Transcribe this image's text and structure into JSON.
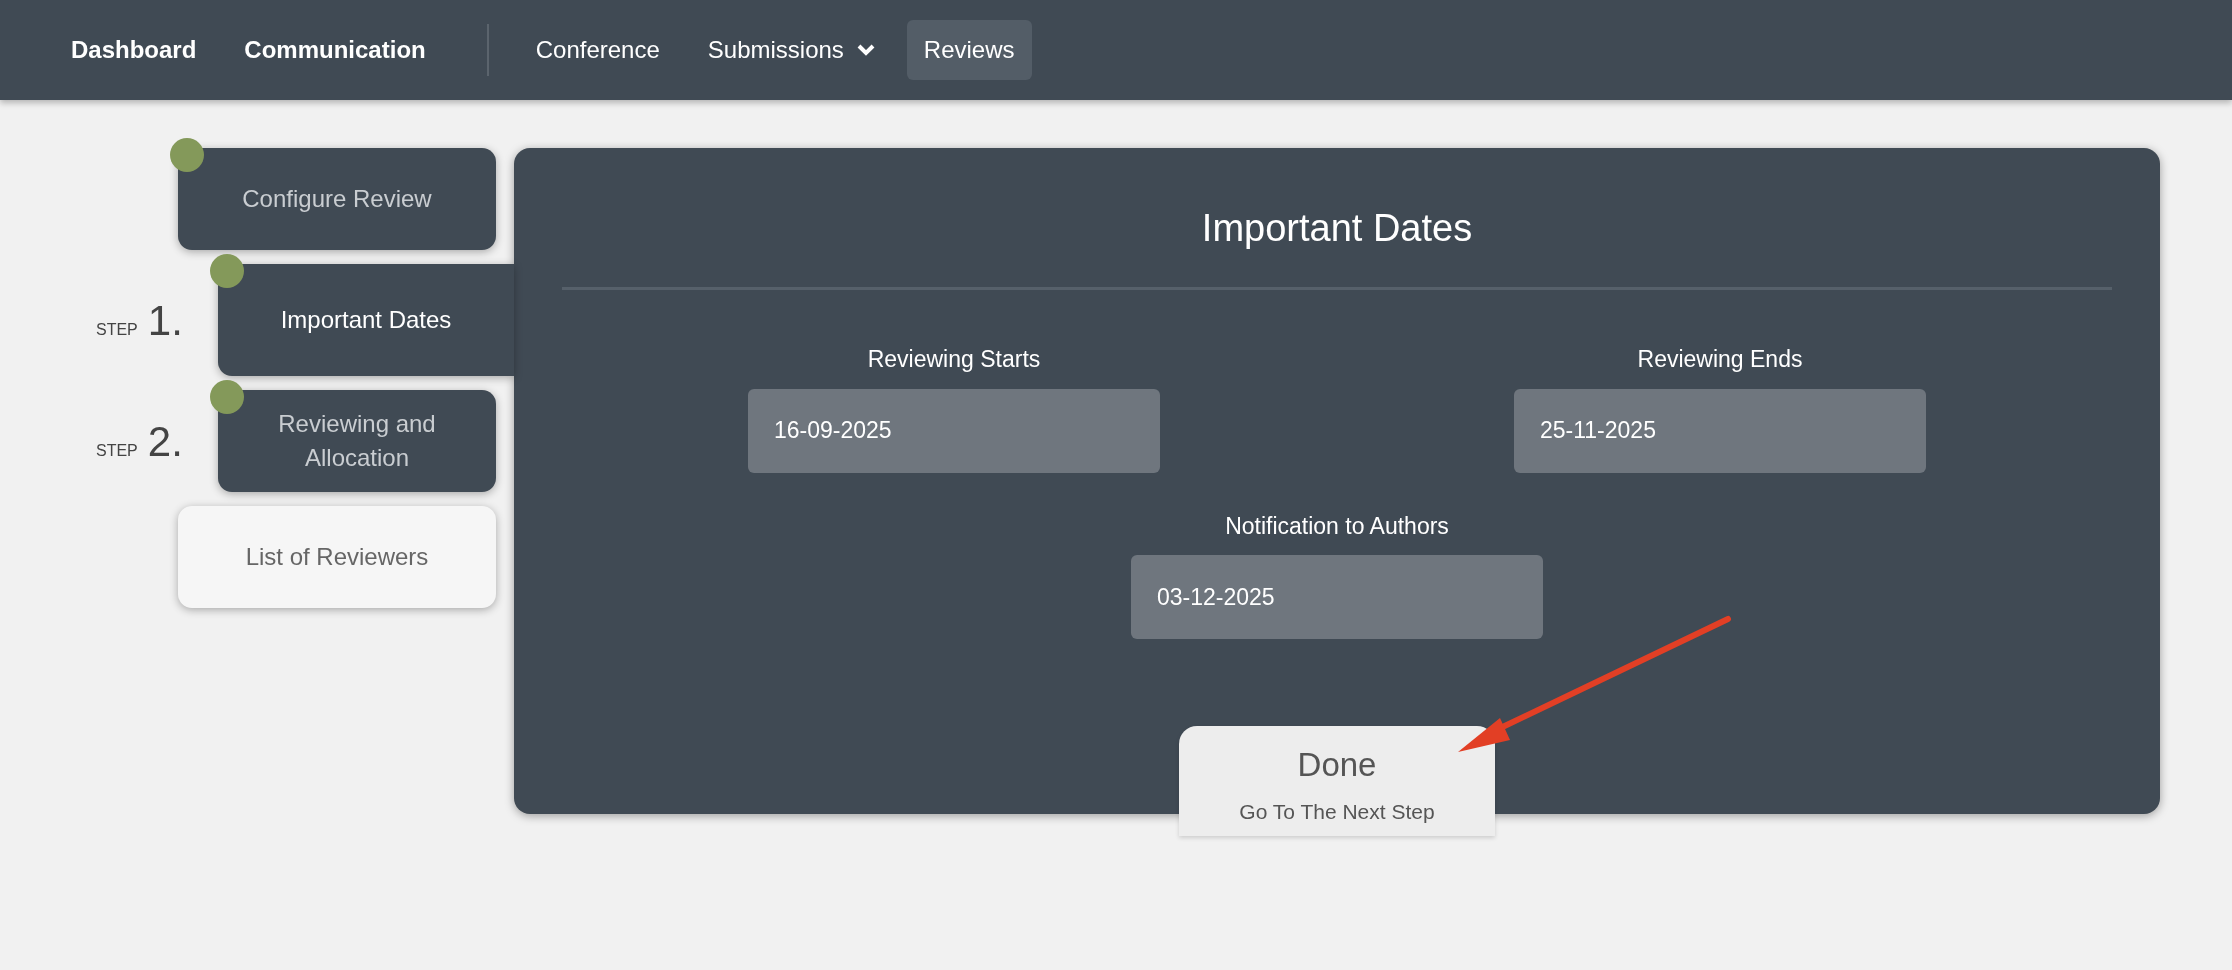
{
  "nav": [
    {
      "label": "Dashboard",
      "kind": "primary",
      "selected": false,
      "has_menu": false
    },
    {
      "label": "Communication",
      "kind": "primary",
      "selected": false,
      "has_menu": false
    },
    {
      "label": "Conference",
      "kind": "secondary",
      "selected": false,
      "has_menu": false
    },
    {
      "label": "Submissions",
      "kind": "secondary",
      "selected": false,
      "has_menu": true
    },
    {
      "label": "Reviews",
      "kind": "secondary",
      "selected": true,
      "has_menu": false
    }
  ],
  "steps": [
    {
      "label": "Configure Review",
      "kind": "stage",
      "completed": true,
      "selected": false
    },
    {
      "step_word": "STEP",
      "step_number": "1.",
      "label": "Important Dates",
      "kind": "stage",
      "completed": true,
      "selected": true
    },
    {
      "step_word": "STEP",
      "step_number": "2.",
      "label": "Reviewing and Allocation",
      "kind": "stage",
      "completed": true,
      "selected": false
    },
    {
      "label": "List of Reviewers",
      "kind": "link",
      "completed": false,
      "selected": false
    }
  ],
  "panel": {
    "title": "Important Dates",
    "fields": [
      {
        "label": "Reviewing Starts",
        "value": "16-09-2025"
      },
      {
        "label": "Reviewing Ends",
        "value": "25-11-2025"
      },
      {
        "label": "Notification to Authors",
        "value": "03-12-2025"
      }
    ],
    "done_button": {
      "label": "Done",
      "subtitle": "Go To The Next Step"
    }
  }
}
